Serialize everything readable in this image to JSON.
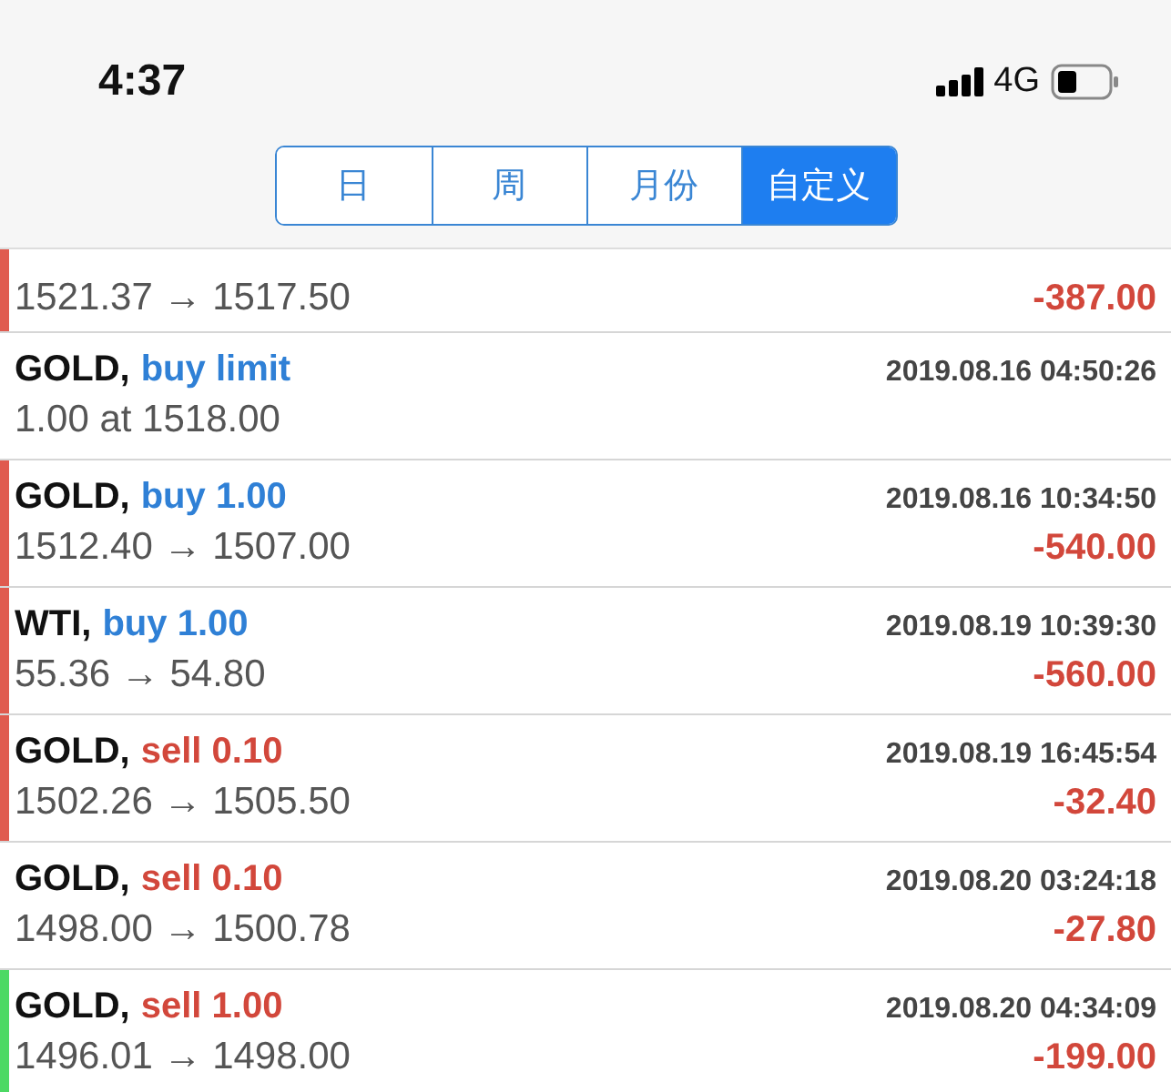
{
  "status_bar": {
    "time": "4:37",
    "network": "4G"
  },
  "segments": [
    {
      "label": "日",
      "selected": false
    },
    {
      "label": "周",
      "selected": false
    },
    {
      "label": "月份",
      "selected": false
    },
    {
      "label": "自定义",
      "selected": true
    }
  ],
  "rows": [
    {
      "prices": "1521.37 → 1517.50",
      "profit": "-387.00",
      "color": "#e05a4e"
    },
    {
      "symbol": "GOLD,",
      "kind": "buy",
      "action": "buy limit",
      "time": "2019.08.16 04:50:26",
      "prices": "1.00 at 1518.00"
    },
    {
      "symbol": "GOLD,",
      "kind": "buy",
      "action": "buy 1.00",
      "time": "2019.08.16 10:34:50",
      "prices": "1512.40 → 1507.00",
      "profit": "-540.00",
      "color": "#e05a4e"
    },
    {
      "symbol": "WTI,",
      "kind": "buy",
      "action": "buy 1.00",
      "time": "2019.08.19 10:39:30",
      "prices": "55.36 → 54.80",
      "profit": "-560.00",
      "color": "#e05a4e"
    },
    {
      "symbol": "GOLD,",
      "kind": "sell",
      "action": "sell 0.10",
      "time": "2019.08.19 16:45:54",
      "prices": "1502.26 → 1505.50",
      "profit": "-32.40",
      "color": "#e05a4e"
    },
    {
      "symbol": "GOLD,",
      "kind": "sell",
      "action": "sell 0.10",
      "time": "2019.08.20 03:24:18",
      "prices": "1498.00 → 1500.78",
      "profit": "-27.80"
    },
    {
      "symbol": "GOLD,",
      "kind": "sell",
      "action": "sell 1.00",
      "time": "2019.08.20 04:34:09",
      "prices": "1496.01 → 1498.00",
      "profit": "-199.00",
      "color": "#4cd964"
    }
  ]
}
